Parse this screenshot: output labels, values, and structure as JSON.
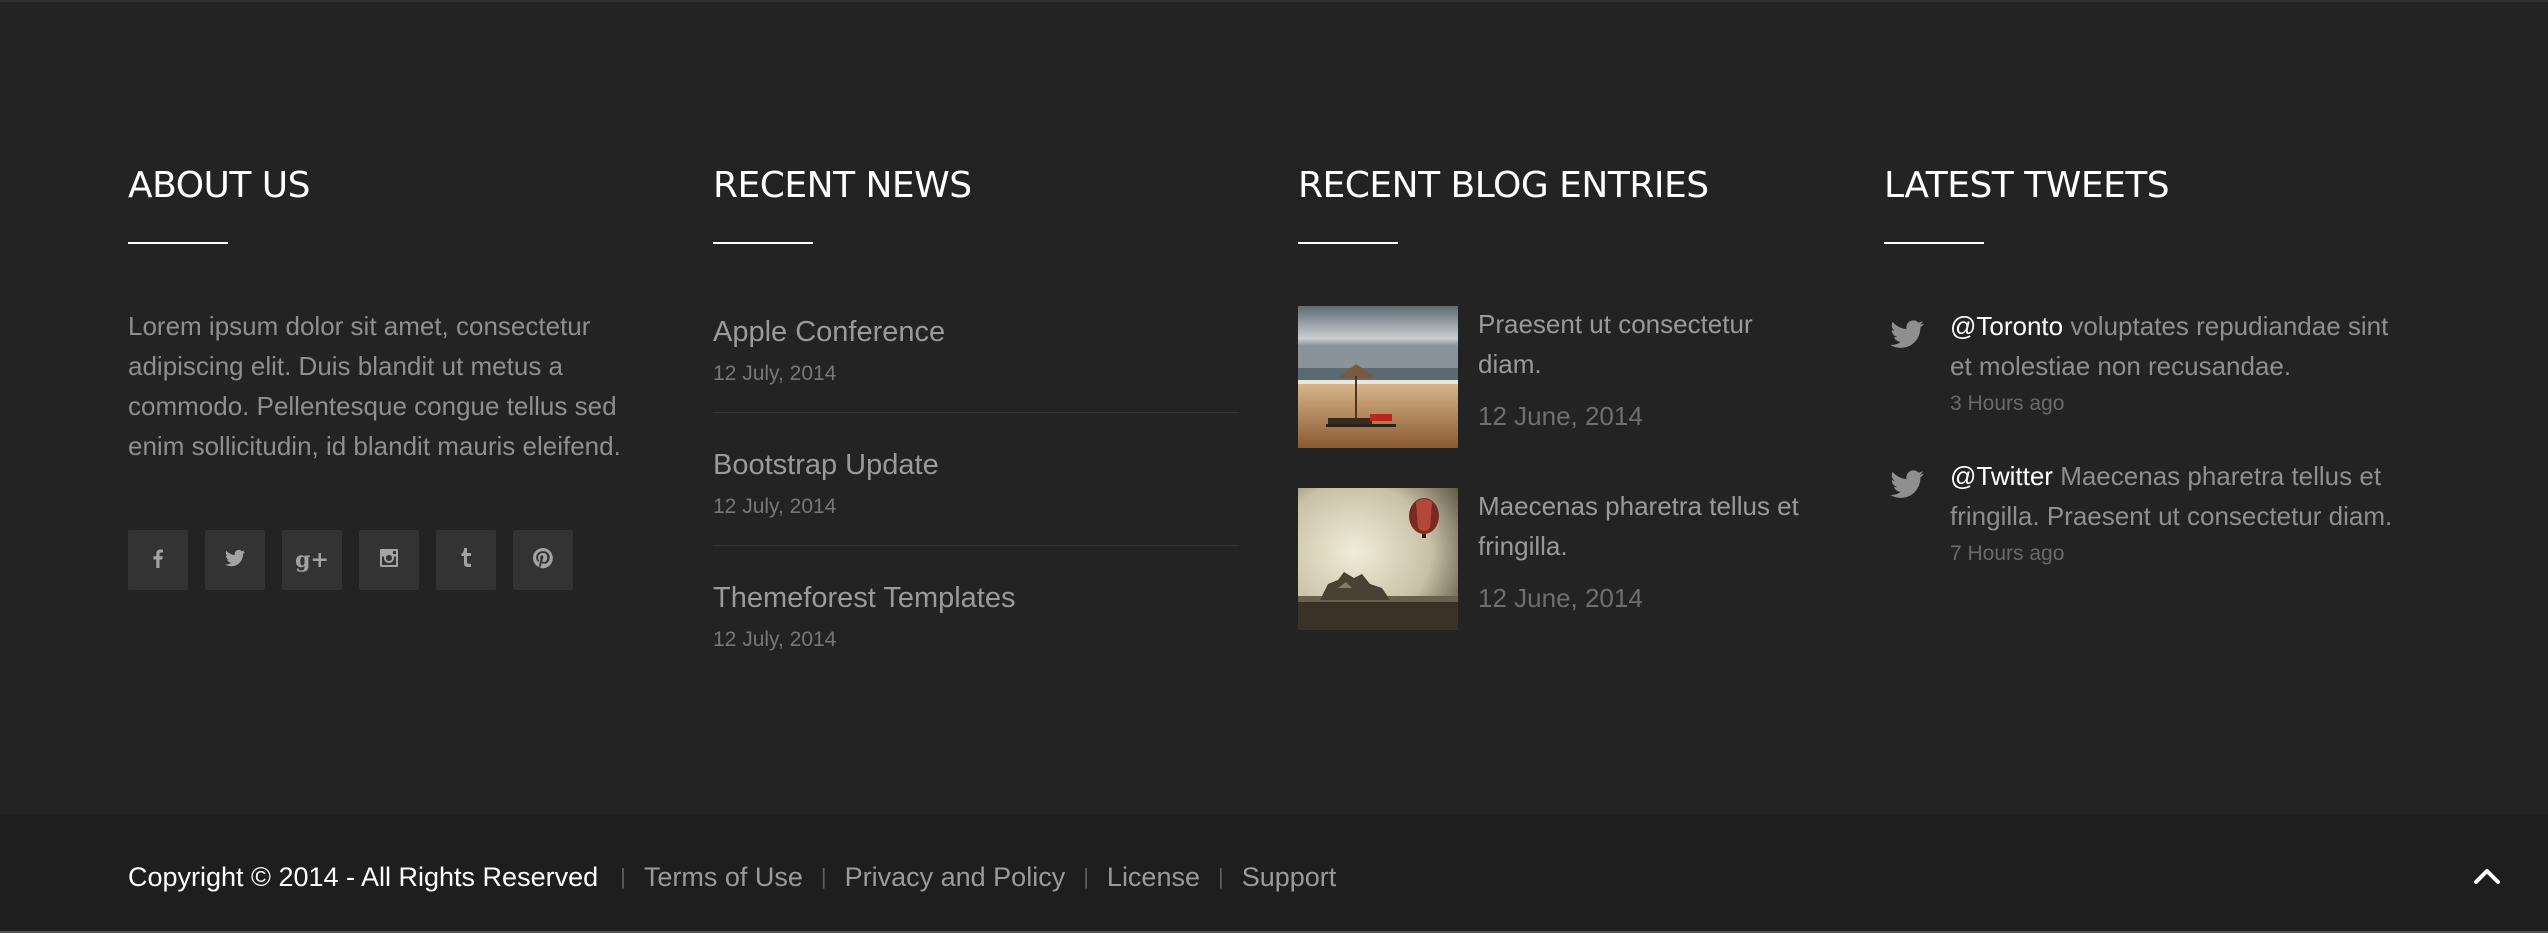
{
  "about": {
    "title": "ABOUT US",
    "text": "Lorem ipsum dolor sit amet, consectetur adipiscing elit. Duis blandit ut metus a commodo. Pellentesque congue tellus sed enim sollicitudin, id blandit mauris eleifend.",
    "social_icons": [
      "facebook-icon",
      "twitter-icon",
      "google-plus-icon",
      "instagram-icon",
      "tumblr-icon",
      "pinterest-icon"
    ]
  },
  "news": {
    "title": "RECENT NEWS",
    "items": [
      {
        "title": "Apple Conference",
        "date": "12 July, 2014"
      },
      {
        "title": "Bootstrap Update",
        "date": "12 July, 2014"
      },
      {
        "title": "Themeforest Templates",
        "date": "12 July, 2014"
      }
    ]
  },
  "blog": {
    "title": "RECENT BLOG ENTRIES",
    "items": [
      {
        "title": "Praesent ut consectetur diam.",
        "date": "12 June, 2014",
        "thumb": "beach-umbrella-photo"
      },
      {
        "title": "Maecenas pharetra tellus et fringilla.",
        "date": "12 June, 2014",
        "thumb": "hot-air-balloon-photo"
      }
    ]
  },
  "tweets": {
    "title": "LATEST TWEETS",
    "items": [
      {
        "handle": "@Toronto",
        "text": " voluptates repudiandae sint et molestiae non recusandae.",
        "time": "3 Hours ago"
      },
      {
        "handle": "@Twitter",
        "text": " Maecenas pharetra tellus et fringilla. Praesent ut consectetur diam.",
        "time": "7 Hours ago"
      }
    ]
  },
  "bottom": {
    "copyright": "Copyright © 2014 - All Rights Reserved",
    "separator": "|",
    "links": [
      "Terms of Use",
      "Privacy and Policy",
      "License",
      "Support"
    ],
    "to_top_icon": "chevron-up-icon"
  },
  "colors": {
    "background": "#232323",
    "bottom_bar": "#1e1e1e",
    "heading": "#ffffff",
    "muted_text": "#8f8f8f",
    "social_button": "#333333"
  }
}
